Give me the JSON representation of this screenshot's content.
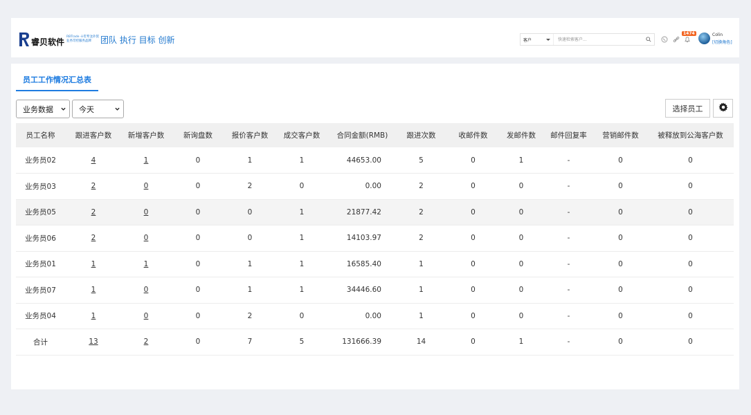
{
  "header": {
    "logo_name": "睿贝软件",
    "logo_sub_lines": [
      "RBTrade 十年专注外贸",
      "十年专注外贸",
      "业务可控服务品牌"
    ],
    "slogan": "团队 执行 目标 创新",
    "search": {
      "type_value": "客户",
      "placeholder": "快速检索客户..."
    },
    "notification_count": "1474",
    "user_name": "Colin",
    "switch_role": "[切换角色]"
  },
  "panel": {
    "tab_label": "员工工作情况汇总表",
    "filter_category": "业务数据",
    "filter_period": "今天",
    "select_employee_label": "选择员工"
  },
  "table": {
    "columns": [
      "员工名称",
      "跟进客户数",
      "新增客户数",
      "新询盘数",
      "报价客户数",
      "成交客户数",
      "合同金额(RMB)",
      "跟进次数",
      "收邮件数",
      "发邮件数",
      "邮件回复率",
      "营销邮件数",
      "被释放到公海客户数"
    ],
    "rows": [
      [
        "业务员02",
        "4",
        "1",
        "0",
        "1",
        "1",
        "44653.00",
        "5",
        "0",
        "1",
        "-",
        "0",
        "0"
      ],
      [
        "业务员03",
        "2",
        "0",
        "0",
        "2",
        "0",
        "0.00",
        "2",
        "0",
        "0",
        "-",
        "0",
        "0"
      ],
      [
        "业务员05",
        "2",
        "0",
        "0",
        "0",
        "1",
        "21877.42",
        "2",
        "0",
        "0",
        "-",
        "0",
        "0"
      ],
      [
        "业务员06",
        "2",
        "0",
        "0",
        "0",
        "1",
        "14103.97",
        "2",
        "0",
        "0",
        "-",
        "0",
        "0"
      ],
      [
        "业务员01",
        "1",
        "1",
        "0",
        "1",
        "1",
        "16585.40",
        "1",
        "0",
        "0",
        "-",
        "0",
        "0"
      ],
      [
        "业务员07",
        "1",
        "0",
        "0",
        "1",
        "1",
        "34446.60",
        "1",
        "0",
        "0",
        "-",
        "0",
        "0"
      ],
      [
        "业务员04",
        "1",
        "0",
        "0",
        "2",
        "0",
        "0.00",
        "1",
        "0",
        "0",
        "-",
        "0",
        "0"
      ],
      [
        "合计",
        "13",
        "2",
        "0",
        "7",
        "5",
        "131666.39",
        "14",
        "0",
        "1",
        "-",
        "0",
        "0"
      ]
    ],
    "highlighted_row": 2
  },
  "colors": {
    "accent": "#1e7ce0",
    "badge": "#f26522",
    "header_bg": "#f0f0f0",
    "page_bg": "#eef0f4"
  }
}
